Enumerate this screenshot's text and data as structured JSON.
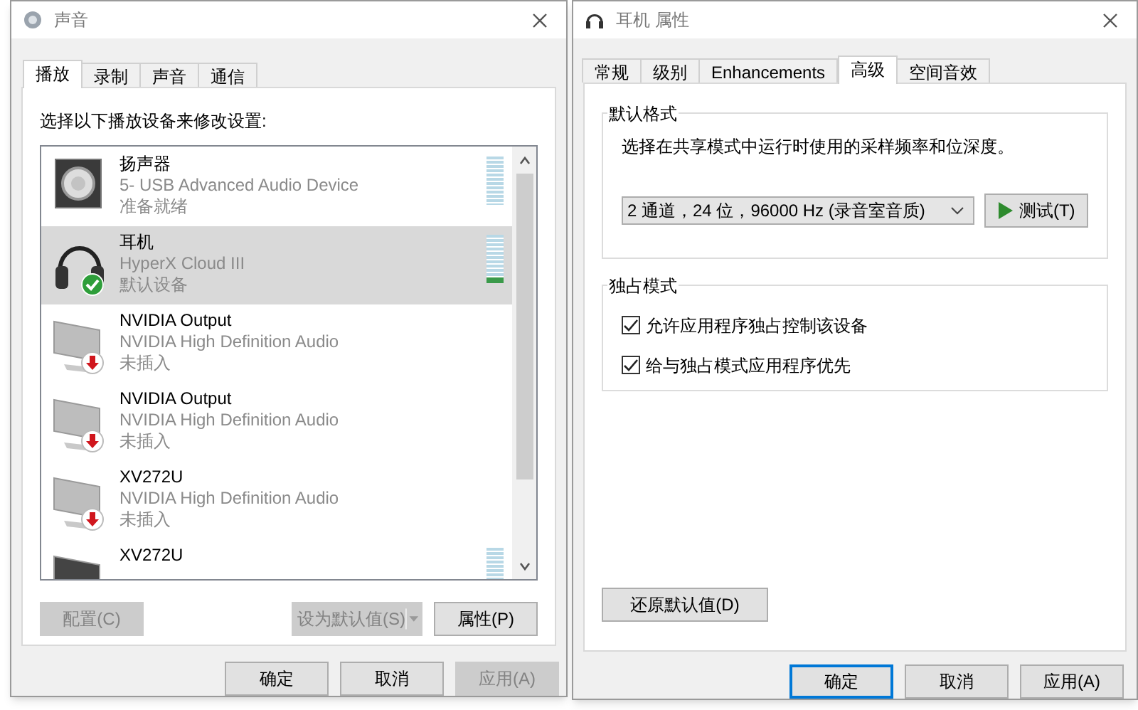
{
  "sound_window": {
    "title": "声音",
    "tabs": [
      {
        "label": "播放",
        "selected": true
      },
      {
        "label": "录制",
        "selected": false
      },
      {
        "label": "声音",
        "selected": false
      },
      {
        "label": "通信",
        "selected": false
      }
    ],
    "instruction": "选择以下播放设备来修改设置:",
    "devices": [
      {
        "kind": "speaker",
        "name": "扬声器",
        "description": "5- USB Advanced Audio Device",
        "status": "准备就绪",
        "default_device": false,
        "unplugged": false,
        "selected": false,
        "level": 0
      },
      {
        "kind": "headphones",
        "name": "耳机",
        "description": "HyperX Cloud III",
        "status": "默认设备",
        "default_device": true,
        "unplugged": false,
        "selected": true,
        "level": 0.1
      },
      {
        "kind": "monitor",
        "name": "NVIDIA Output",
        "description": "NVIDIA High Definition Audio",
        "status": "未插入",
        "default_device": false,
        "unplugged": true,
        "selected": false
      },
      {
        "kind": "monitor",
        "name": "NVIDIA Output",
        "description": "NVIDIA High Definition Audio",
        "status": "未插入",
        "default_device": false,
        "unplugged": true,
        "selected": false
      },
      {
        "kind": "monitor",
        "name": "XV272U",
        "description": "NVIDIA High Definition Audio",
        "status": "未插入",
        "default_device": false,
        "unplugged": true,
        "selected": false
      },
      {
        "kind": "monitor_dark",
        "name": "XV272U",
        "default_device": false,
        "unplugged": false,
        "selected": false,
        "level": 0
      }
    ],
    "list_buttons": [
      {
        "label": "配置(C)",
        "disabled": true
      },
      {
        "label": "设为默认值(S)",
        "disabled": true
      },
      {
        "label": "属性(P)",
        "disabled": false
      }
    ],
    "dialog_buttons": [
      {
        "label": "确定",
        "disabled": false,
        "focused": false
      },
      {
        "label": "取消",
        "disabled": false,
        "focused": false
      },
      {
        "label": "应用(A)",
        "disabled": true,
        "focused": false
      }
    ]
  },
  "properties_window": {
    "title": "耳机 属性",
    "tabs": [
      {
        "label": "常规",
        "selected": false
      },
      {
        "label": "级别",
        "selected": false
      },
      {
        "label": "Enhancements",
        "selected": false
      },
      {
        "label": "高级",
        "selected": true
      },
      {
        "label": "空间音效",
        "selected": false
      }
    ],
    "default_format": {
      "heading": "默认格式",
      "description": "选择在共享模式中运行时使用的采样频率和位深度。",
      "format_value": "2 通道，24 位，96000 Hz (录音室音质)",
      "test_button": "测试(T)"
    },
    "exclusive_mode": {
      "heading": "独占模式",
      "options": [
        {
          "label": "允许应用程序独占控制该设备",
          "checked": true
        },
        {
          "label": "给与独占模式应用程序优先",
          "checked": true
        }
      ]
    },
    "restore_button": "还原默认值(D)",
    "dialog_buttons": [
      {
        "label": "确定",
        "disabled": false,
        "focused": true
      },
      {
        "label": "取消",
        "disabled": false,
        "focused": false
      },
      {
        "label": "应用(A)",
        "disabled": false,
        "focused": false
      }
    ]
  }
}
